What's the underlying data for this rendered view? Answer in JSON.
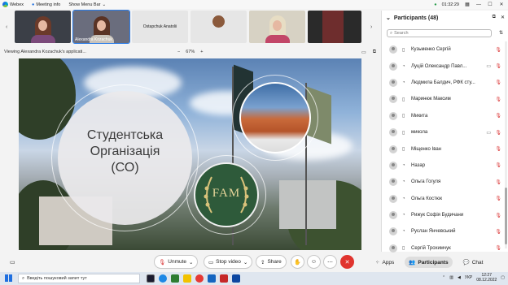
{
  "topbar": {
    "app_name": "Webex",
    "meeting_info": "Meeting info",
    "show_menu_bar": "Show Menu Bar",
    "timer": "01:32:29"
  },
  "strip": {
    "tiles": [
      {
        "name": ""
      },
      {
        "name": "Alexandra Kozachuk"
      },
      {
        "name": "Ostapchuk Anatolii"
      },
      {
        "name": ""
      },
      {
        "name": ""
      },
      {
        "name": ""
      }
    ]
  },
  "viewbar": {
    "title": "Viewing Alexandra Kozachuk's applicati...",
    "zoom_minus": "−",
    "zoom": "67%",
    "zoom_plus": "+"
  },
  "slide": {
    "title_line1": "Студентська",
    "title_line2": "Організація",
    "title_line3": "(СО)",
    "logo_text": "FAM"
  },
  "controls": {
    "unmute": "Unmute",
    "stop_video": "Stop video",
    "share": "Share",
    "more": "⋯"
  },
  "right_buttons": {
    "apps": "Apps",
    "participants": "Participants",
    "chat": "Chat"
  },
  "panel": {
    "title": "Participants (48)",
    "search_placeholder": "Search",
    "participants": [
      {
        "name": "Кузьменко Сергій",
        "device": "phone",
        "camera": false
      },
      {
        "name": "Луцій Олександр Павл...",
        "device": "headset",
        "camera": true
      },
      {
        "name": "Людмила Балдич, РФК сту...",
        "device": "headset",
        "camera": false
      },
      {
        "name": "Маринюк Максим",
        "device": "phone",
        "camera": false
      },
      {
        "name": "Микита",
        "device": "phone",
        "camera": false
      },
      {
        "name": "микола",
        "device": "phone",
        "camera": true
      },
      {
        "name": "Міщенко Іван",
        "device": "phone",
        "camera": false
      },
      {
        "name": "Назар",
        "device": "headset",
        "camera": false
      },
      {
        "name": "Ольга Гогуля",
        "device": "headset",
        "camera": false
      },
      {
        "name": "Ольга Костюк",
        "device": "headset",
        "camera": false
      },
      {
        "name": "Рижук Софія Будичани",
        "device": "headset",
        "camera": false
      },
      {
        "name": "Руслан Янчевський",
        "device": "headset",
        "camera": false
      },
      {
        "name": "Сергій Трохимчук",
        "device": "phone",
        "camera": false
      }
    ]
  },
  "taskbar": {
    "search_placeholder": "Введіть пошуковий запит тут",
    "lang": "УКР",
    "time": "12:27",
    "date": "08.12.2022"
  }
}
